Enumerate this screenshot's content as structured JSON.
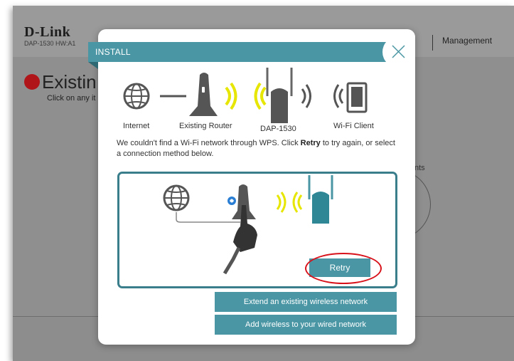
{
  "background": {
    "brand": "D-Link",
    "model": "DAP-1530  HW:A1",
    "nav_management": "Management",
    "section_title": "Existin",
    "section_subtitle": "Click on any it",
    "clients_fragment": "nts"
  },
  "modal": {
    "title": "INSTALL",
    "diagram_labels": {
      "internet": "Internet",
      "router": "Existing Router",
      "extender": "DAP-1530",
      "client": "Wi-Fi Client"
    },
    "message_before": "We couldn't find a Wi-Fi network through WPS. Click ",
    "message_bold": "Retry",
    "message_after": " to try again, or select a connection method below.",
    "retry_label": "Retry",
    "extend_label": "Extend an existing wireless network",
    "add_wireless_label": "Add wireless to your wired network"
  },
  "colors": {
    "accent": "#4a96a4",
    "accent_dark": "#3a7e8c",
    "signal": "#e6e600",
    "highlight_ring": "#d8121b",
    "logo_red": "#b0151a"
  }
}
